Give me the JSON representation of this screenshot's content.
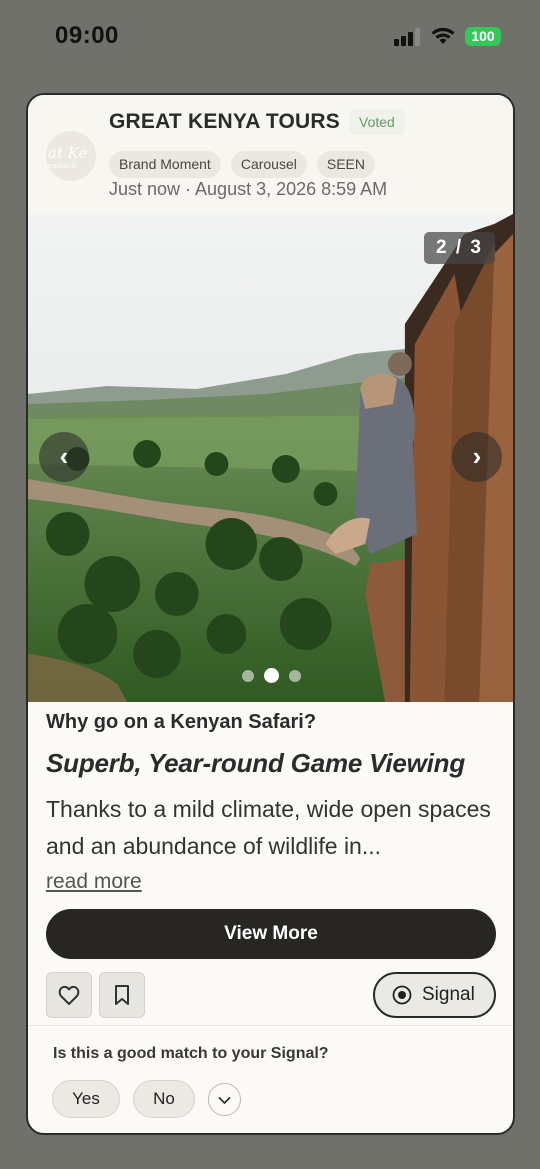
{
  "status_bar": {
    "time": "09:00",
    "battery": "100"
  },
  "post": {
    "brand_name": "GREAT KENYA TOURS",
    "voted_badge": "Voted",
    "tags": [
      "Brand Moment",
      "Carousel",
      "SEEN"
    ],
    "timestamp": "Just now · August 3, 2026 8:59 AM",
    "carousel": {
      "counter": "2 / 3",
      "current": 2,
      "total": 3,
      "prev_icon": "‹",
      "next_icon": "›"
    },
    "question": "Why go on a Kenyan Safari?",
    "headline": "Superb, Year-round Game Viewing",
    "excerpt": "Thanks to a mild climate, wide open spaces and an abundance of wildlife in...",
    "read_more": "read more",
    "view_more_label": "View More",
    "signal_label": "Signal",
    "match_question": "Is this a good match to your Signal?",
    "yes_label": "Yes",
    "no_label": "No"
  },
  "icons": [
    "signal-strength-icon",
    "wifi-icon",
    "battery-icon",
    "heart-icon",
    "bookmark-icon",
    "signal-target-icon",
    "chevron-down-icon"
  ],
  "colors": {
    "background": "#71716c",
    "card": "#fbfaf7",
    "primary_button": "#272623",
    "voted": "#6b9a63",
    "battery": "#35c759"
  }
}
